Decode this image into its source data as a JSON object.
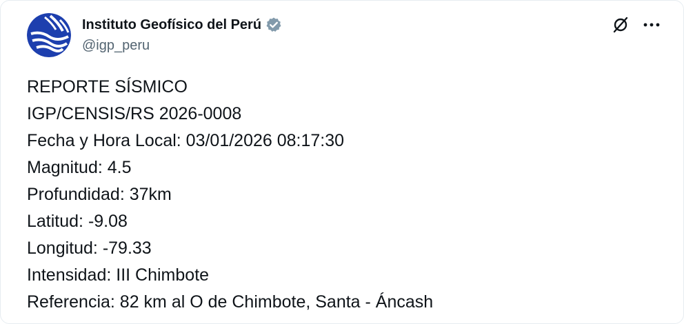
{
  "author": {
    "display_name": "Instituto Geofísico del Perú",
    "handle": "@igp_peru",
    "verified_icon": "verified-badge-gold-icon",
    "avatar_icon": "igp-logo-icon"
  },
  "actions": {
    "grok_icon": "grok-icon",
    "more_icon": "more-horizontal-icon"
  },
  "post": {
    "lines": [
      "REPORTE SÍSMICO",
      "IGP/CENSIS/RS 2026-0008",
      "Fecha y Hora Local: 03/01/2026 08:17:30",
      "Magnitud: 4.5",
      "Profundidad: 37km",
      "Latitud: -9.08",
      "Longitud: -79.33",
      "Intensidad: III Chimbote",
      "Referencia: 82 km al O de Chimbote, Santa - Áncash"
    ]
  },
  "colors": {
    "text_primary": "#0f1419",
    "text_secondary": "#536471",
    "logo_blue": "#1d3fae",
    "logo_bg": "#ffffff",
    "verified_gold": "#8b98a5"
  }
}
